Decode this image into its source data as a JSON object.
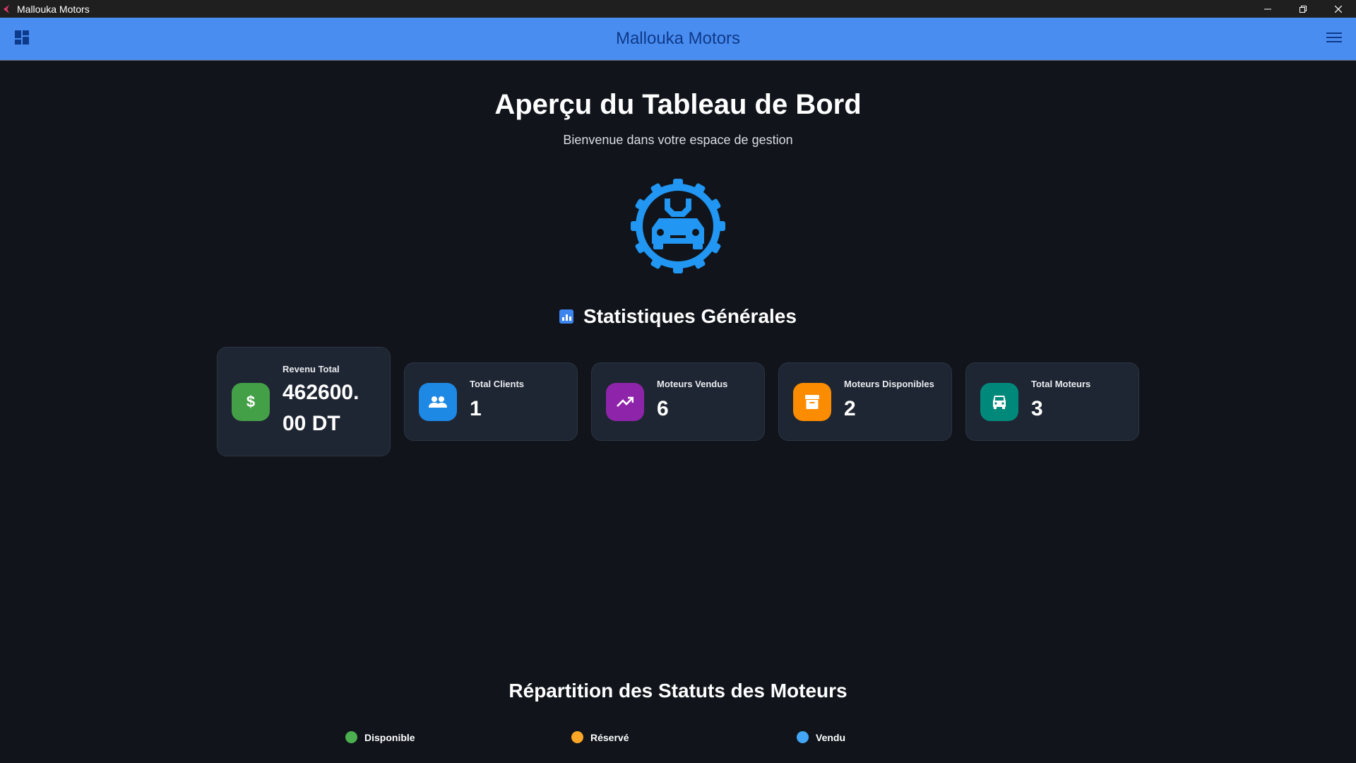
{
  "window": {
    "title": "Mallouka Motors"
  },
  "appbar": {
    "title": "Mallouka Motors"
  },
  "page": {
    "heading": "Aperçu du Tableau de Bord",
    "subtitle": "Bienvenue dans votre espace de gestion"
  },
  "stats": {
    "title": "Statistiques Générales",
    "cards": [
      {
        "label": "Revenu Total",
        "value": "462600.",
        "value2": "00 DT",
        "color": "#43a047",
        "icon": "dollar-icon"
      },
      {
        "label": "Total Clients",
        "value": "1",
        "color": "#1e88e5",
        "icon": "people-icon"
      },
      {
        "label": "Moteurs Vendus",
        "value": "6",
        "color": "#8e24aa",
        "icon": "trending-up-icon"
      },
      {
        "label": "Moteurs Disponibles",
        "value": "2",
        "color": "#fb8c00",
        "icon": "archive-icon"
      },
      {
        "label": "Total Moteurs",
        "value": "3",
        "color": "#00897b",
        "icon": "car-icon"
      }
    ]
  },
  "repartition": {
    "title": "Répartition des Statuts des Moteurs",
    "legend": [
      {
        "label": "Disponible",
        "color": "#4caf50"
      },
      {
        "label": "Réservé",
        "color": "#ffa726"
      },
      {
        "label": "Vendu",
        "color": "#42a5f5"
      }
    ]
  },
  "colors": {
    "accent": "#4a8df0",
    "logo": "#2196f3",
    "background": "#11151b"
  }
}
